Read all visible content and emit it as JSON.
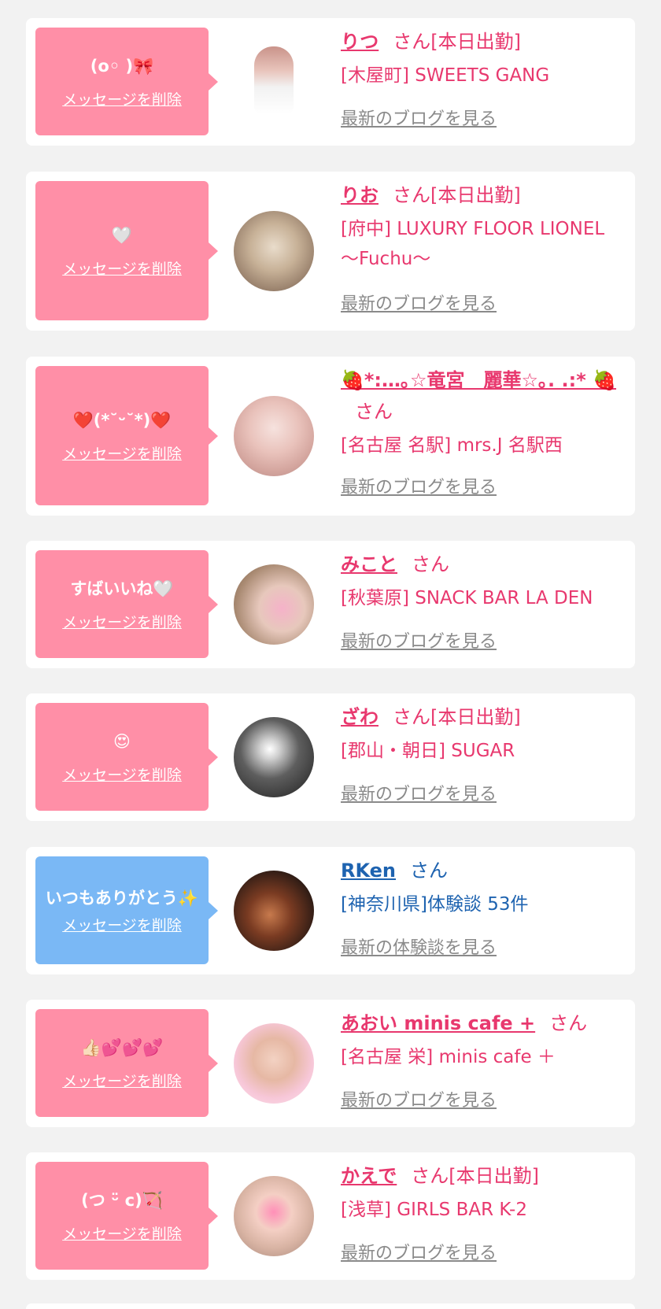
{
  "cards": [
    {
      "message": "(o◦ )🎀",
      "delete_label": "メッセージを削除",
      "name": "りつ",
      "san": "さん[本日出勤]",
      "store": "[木屋町] SWEETS GANG",
      "blog": "最新のブログを見る",
      "bubble_color": "#ff8fa7"
    },
    {
      "message": "🤍",
      "delete_label": "メッセージを削除",
      "name": "りお",
      "san": "さん[本日出勤]",
      "store": "[府中] LUXURY FLOOR LIONEL ～Fuchu～",
      "blog": "最新のブログを見る",
      "bubble_color": "#ff8fa7"
    },
    {
      "message": "❤️(*˘ᵕ˘*)❤️",
      "delete_label": "メッセージを削除",
      "name": "🍓*:…｡☆竜宮　麗華☆｡. .:* 🍓",
      "san": "さん",
      "store": "[名古屋 名駅] mrs.J 名駅西",
      "blog": "最新のブログを見る",
      "bubble_color": "#ff8fa7"
    },
    {
      "message": "すばいいね🤍",
      "delete_label": "メッセージを削除",
      "name": "みこと",
      "san": "さん",
      "store": "[秋葉原] SNACK BAR LA DEN",
      "blog": "最新のブログを見る",
      "bubble_color": "#ff8fa7"
    },
    {
      "message": "😍",
      "delete_label": "メッセージを削除",
      "name": "ざわ",
      "san": "さん[本日出勤]",
      "store": "[郡山・朝日] SUGAR",
      "blog": "最新のブログを見る",
      "bubble_color": "#ff8fa7"
    },
    {
      "message": "いつもありがとう✨",
      "delete_label": "メッセージを削除",
      "name": "RKen",
      "san": "さん",
      "store": "[神奈川県]体験談 53件",
      "blog": "最新の体験談を見る",
      "bubble_color": "#7ab8f5"
    },
    {
      "message": "👍🏻💕💕💕",
      "delete_label": "メッセージを削除",
      "name": "あおい minis cafe +",
      "san": "さん",
      "store": "[名古屋 栄] minis cafe ＋",
      "blog": "最新のブログを見る",
      "bubble_color": "#ff8fa7"
    },
    {
      "message": "(つ ᵕ̈ c)🏹",
      "delete_label": "メッセージを削除",
      "name": "かえで",
      "san": "さん[本日出勤]",
      "store": "[浅草] GIRLS BAR K-2",
      "blog": "最新のブログを見る",
      "bubble_color": "#ff8fa7"
    }
  ]
}
